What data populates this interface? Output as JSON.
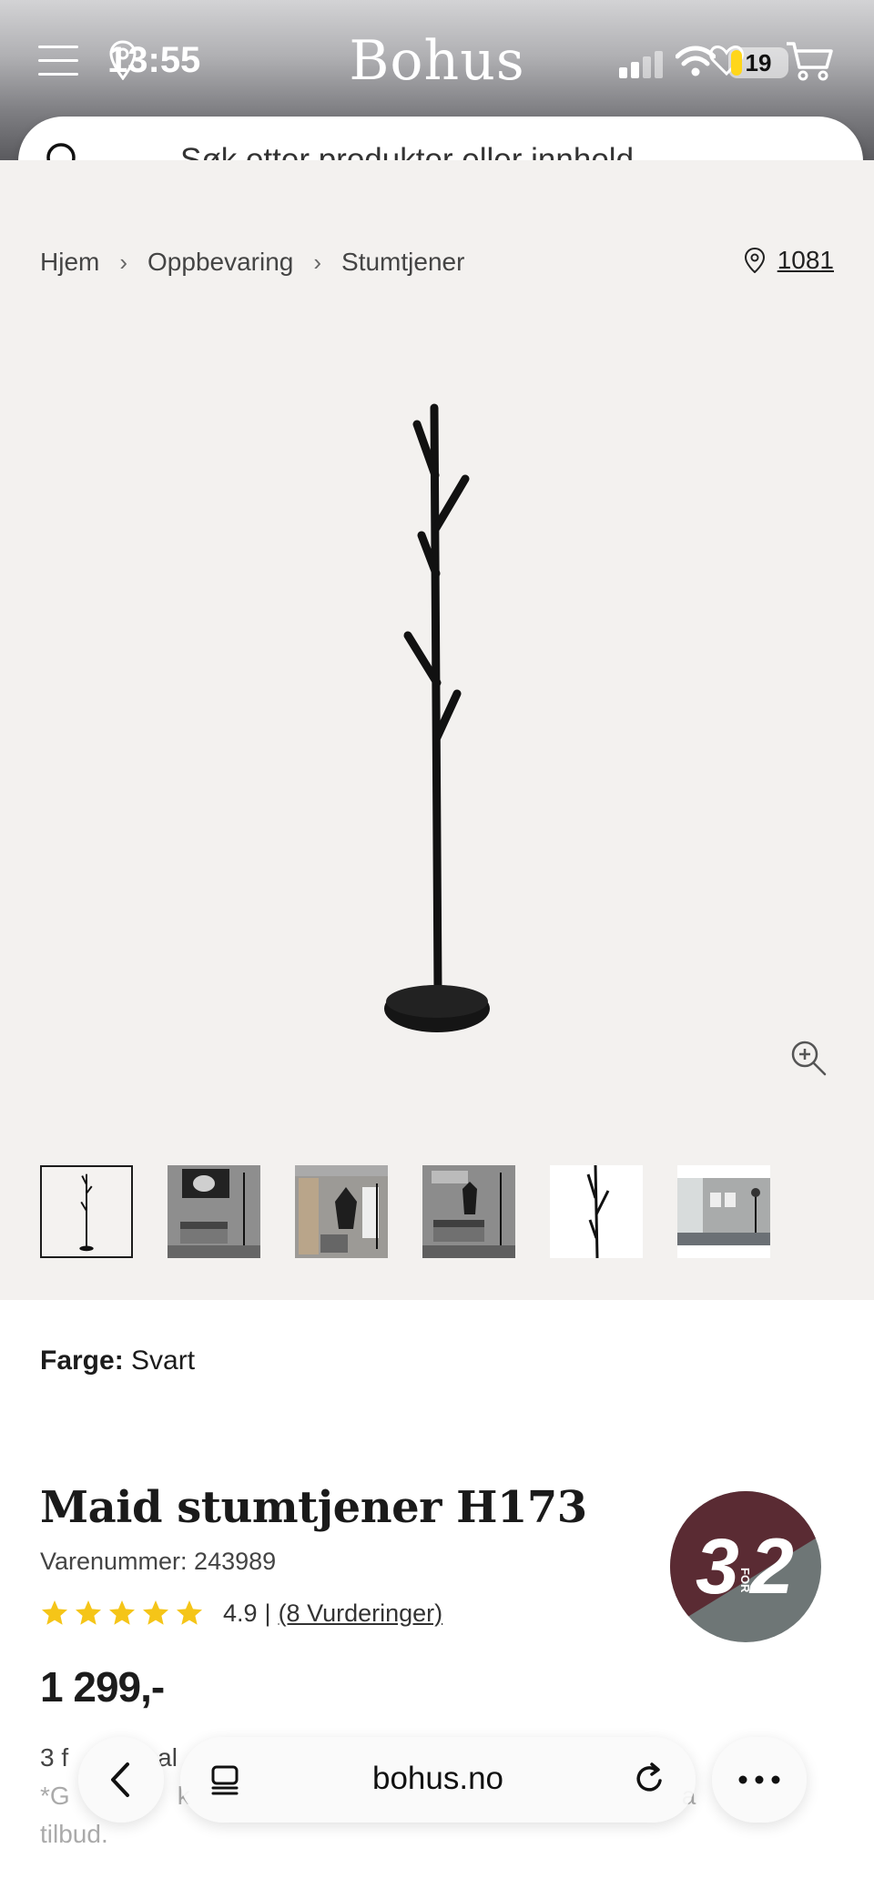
{
  "status_bar": {
    "time": "13:55",
    "battery": "19"
  },
  "header": {
    "brand": "Bohus"
  },
  "search": {
    "placeholder": "Søk etter produkter eller innhold ..."
  },
  "breadcrumb": {
    "items": [
      "Hjem",
      "Oppbevaring",
      "Stumtjener"
    ]
  },
  "store": {
    "label": "1081"
  },
  "gallery": {
    "thumbnail_count": 6,
    "active_index": 0
  },
  "product": {
    "color_label": "Farge:",
    "color_value": "Svart",
    "title": "Maid stumtjener H173",
    "sku": "Varenummer: 243989",
    "rating": 4.9,
    "rating_text": "4.9",
    "rating_separator": "|",
    "reviews": "(8 Vurderinger)",
    "price": "1 299,-"
  },
  "badge": {
    "big": "3",
    "small": "FOR",
    "second": "2",
    "colors": {
      "top": "#5a2b33",
      "bottom": "#6e7676"
    }
  },
  "promo": {
    "line1_start": "3 f",
    "line1_mid": "al",
    "line2_start": "*G",
    "line2_mid": "k",
    "line2_end": "a",
    "line3": "tilbud."
  },
  "browser": {
    "url": "bohus.no"
  },
  "colors": {
    "accent_star": "#f5c518",
    "text": "#1c1c1c",
    "gallery_bg": "#f3f1ef"
  }
}
